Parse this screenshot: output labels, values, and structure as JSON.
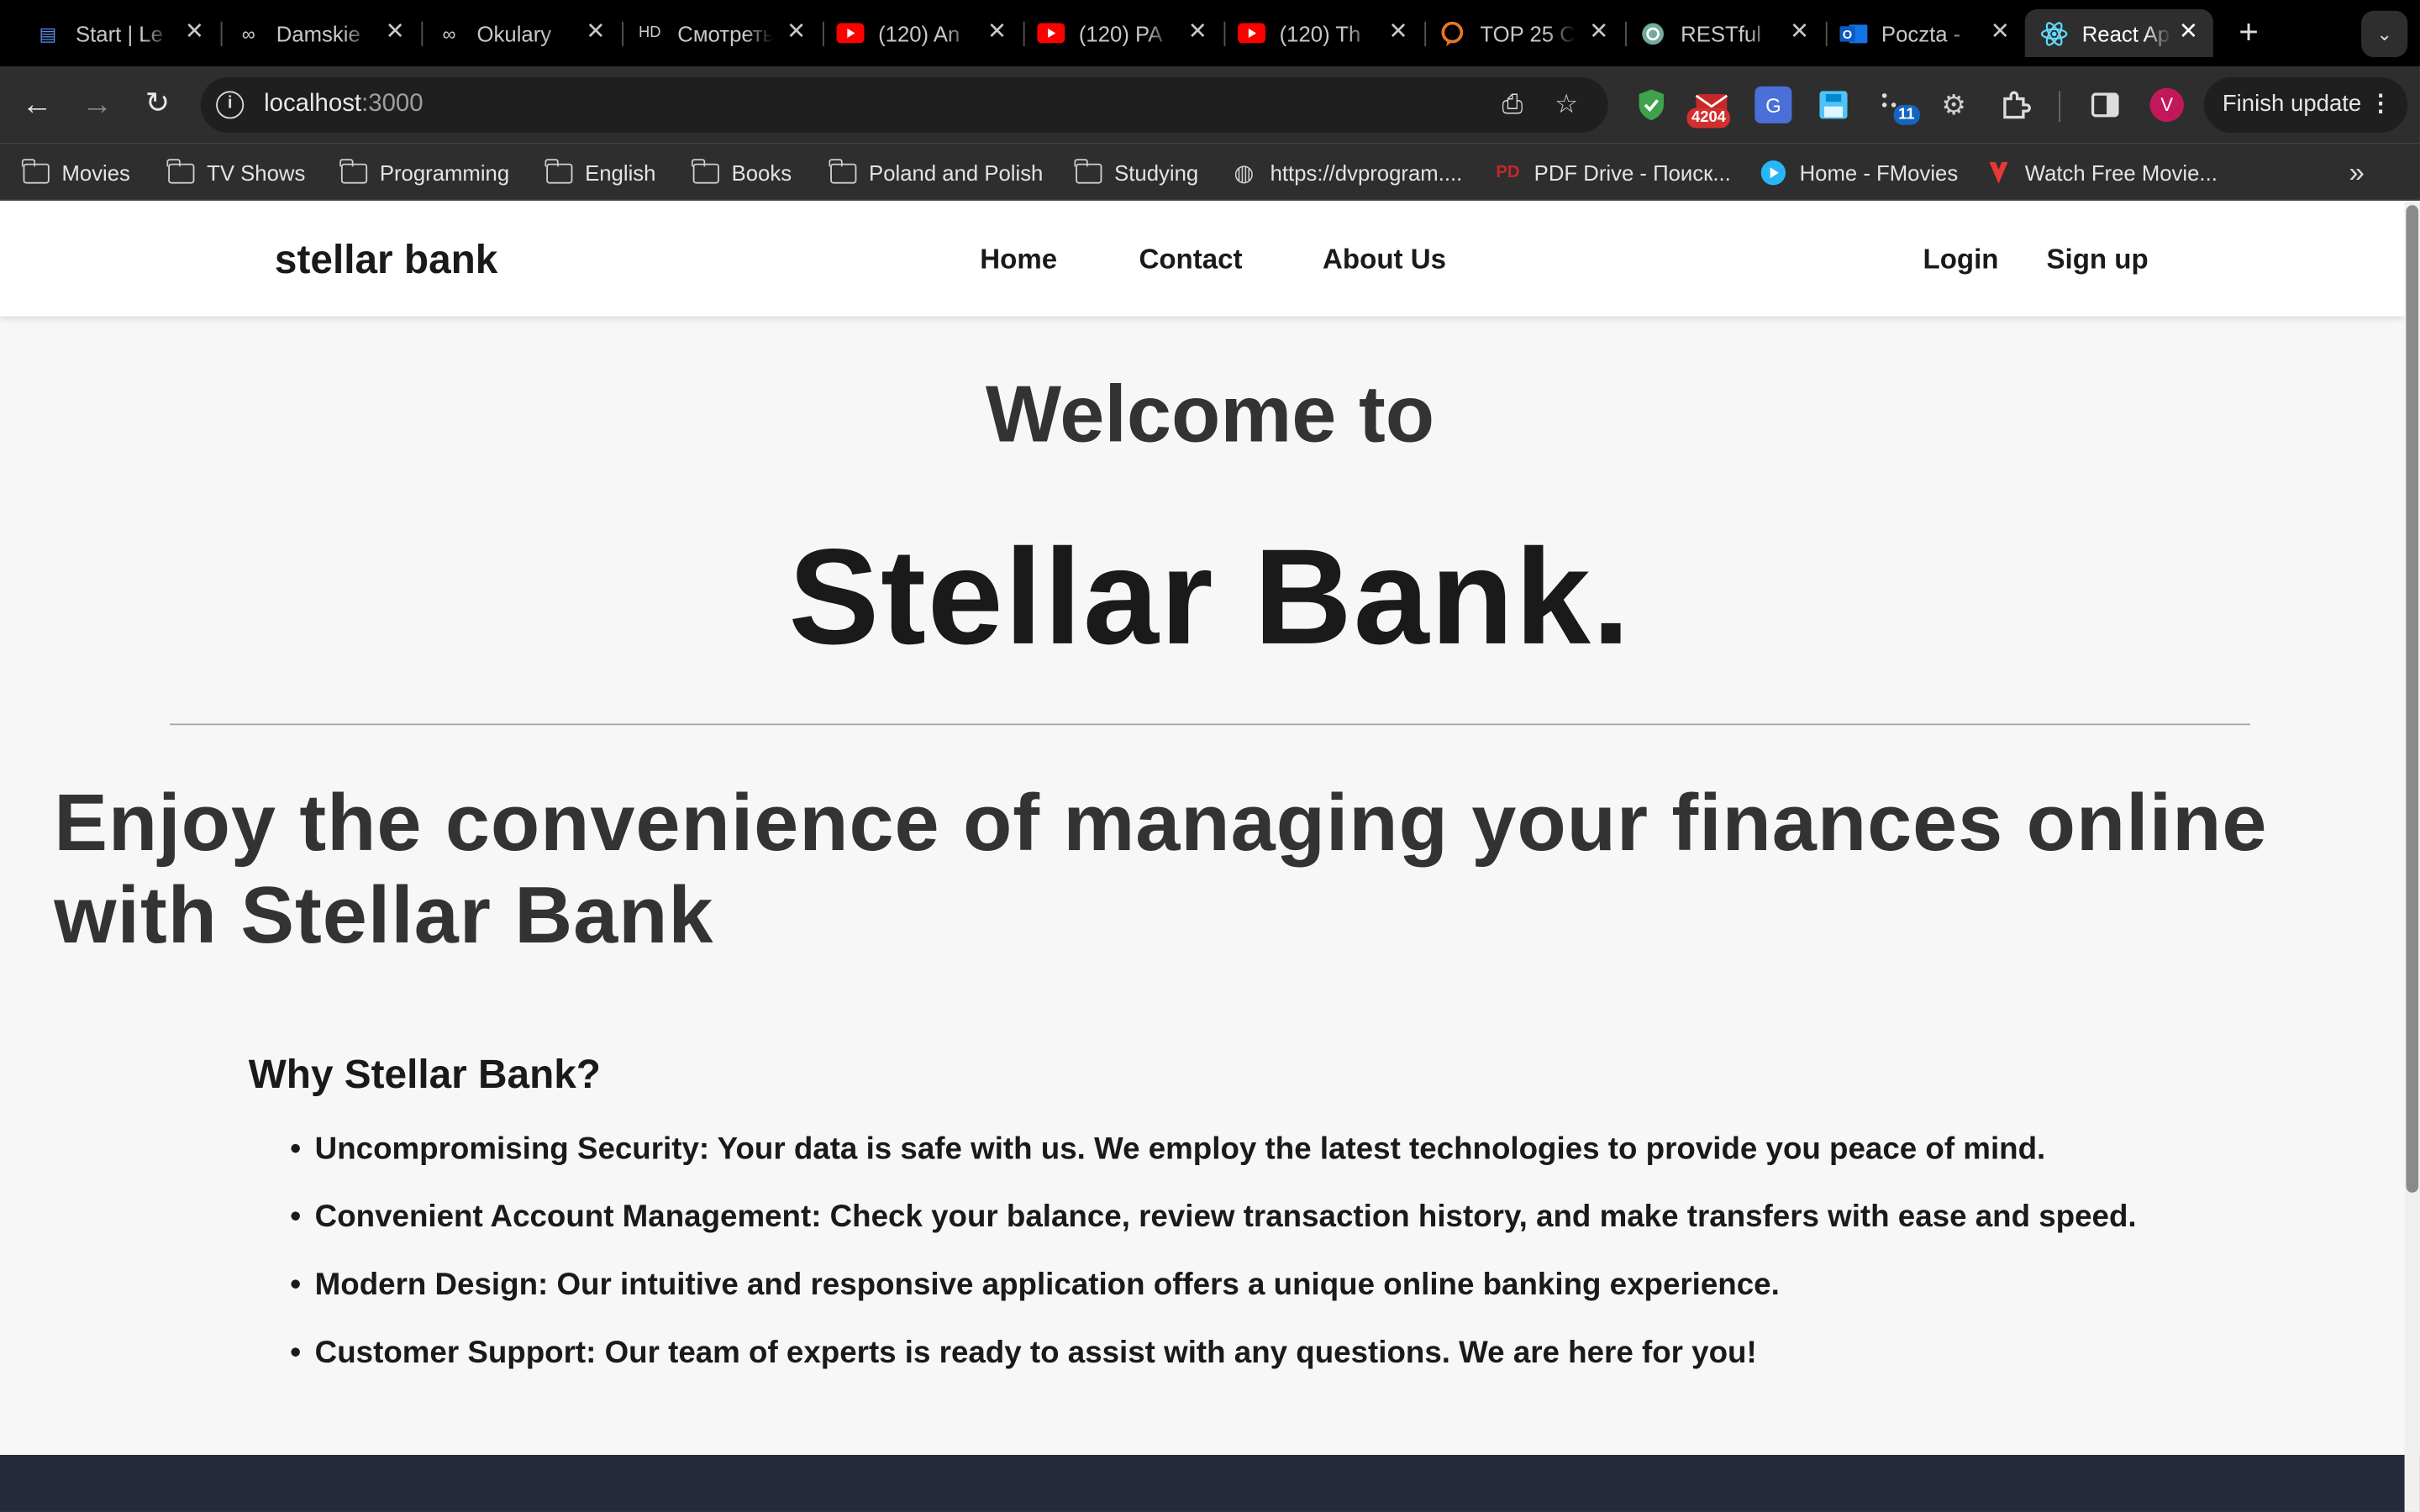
{
  "browser": {
    "tabs": [
      {
        "title": "Start | Le",
        "icon": "book-icon",
        "icon_color": "#5b8def"
      },
      {
        "title": "Damskie",
        "icon": "glasses-icon",
        "icon_color": "#cccccc"
      },
      {
        "title": "Okulary",
        "icon": "glasses-icon",
        "icon_color": "#cccccc"
      },
      {
        "title": "Смотреть",
        "icon": "hd-icon",
        "icon_color": "#cccccc"
      },
      {
        "title": "(120) An",
        "icon": "youtube-icon",
        "icon_color": "#ff0000"
      },
      {
        "title": "(120) PA",
        "icon": "youtube-icon",
        "icon_color": "#ff0000"
      },
      {
        "title": "(120) Th",
        "icon": "youtube-icon",
        "icon_color": "#ff0000"
      },
      {
        "title": "TOP 25 C",
        "icon": "chat-bubble-icon",
        "icon_color": "#e87722"
      },
      {
        "title": "RESTful",
        "icon": "openai-icon",
        "icon_color": "#74aa9c"
      },
      {
        "title": "Poczta -",
        "icon": "outlook-icon",
        "icon_color": "#1473e6"
      },
      {
        "title": "React Ap",
        "icon": "react-icon",
        "icon_color": "#61dafb",
        "active": true
      }
    ],
    "url_host": "localhost",
    "url_port": ":3000",
    "extension_badge_count": "4204",
    "extension_badge_count_2": "11",
    "profile_initial": "V",
    "finish_update_label": "Finish update",
    "bookmarks": [
      {
        "label": "Movies",
        "icon": "folder-icon"
      },
      {
        "label": "TV Shows",
        "icon": "folder-icon"
      },
      {
        "label": "Programming",
        "icon": "folder-icon"
      },
      {
        "label": "English",
        "icon": "folder-icon"
      },
      {
        "label": "Books",
        "icon": "folder-icon"
      },
      {
        "label": "Poland and Polish",
        "icon": "folder-icon"
      },
      {
        "label": "Studying",
        "icon": "folder-icon"
      },
      {
        "label": "https://dvprogram....",
        "icon": "globe-icon"
      },
      {
        "label": "PDF Drive - Поиск...",
        "icon": "pdf-icon"
      },
      {
        "label": "Home - FMovies",
        "icon": "play-icon"
      },
      {
        "label": "Watch Free Movie...",
        "icon": "shield-icon"
      }
    ]
  },
  "site": {
    "brand": "stellar bank",
    "nav": {
      "home": "Home",
      "contact": "Contact",
      "about": "About Us"
    },
    "auth": {
      "login": "Login",
      "signup": "Sign up"
    },
    "welcome": "Welcome to",
    "hero_title": "Stellar Bank.",
    "tagline": "Enjoy the convenience of managing your finances online with Stellar Bank",
    "why_title": "Why Stellar Bank?",
    "features": [
      "Uncompromising Security: Your data is safe with us. We employ the latest technologies to provide you peace of mind.",
      "Convenient Account Management: Check your balance, review transaction history, and make transfers with ease and speed.",
      "Modern Design: Our intuitive and responsive application offers a unique online banking experience.",
      "Customer Support: Our team of experts is ready to assist with any questions. We are here for you!"
    ],
    "colors": {
      "footer": "#262a3a",
      "background": "#f7f7f7"
    }
  }
}
